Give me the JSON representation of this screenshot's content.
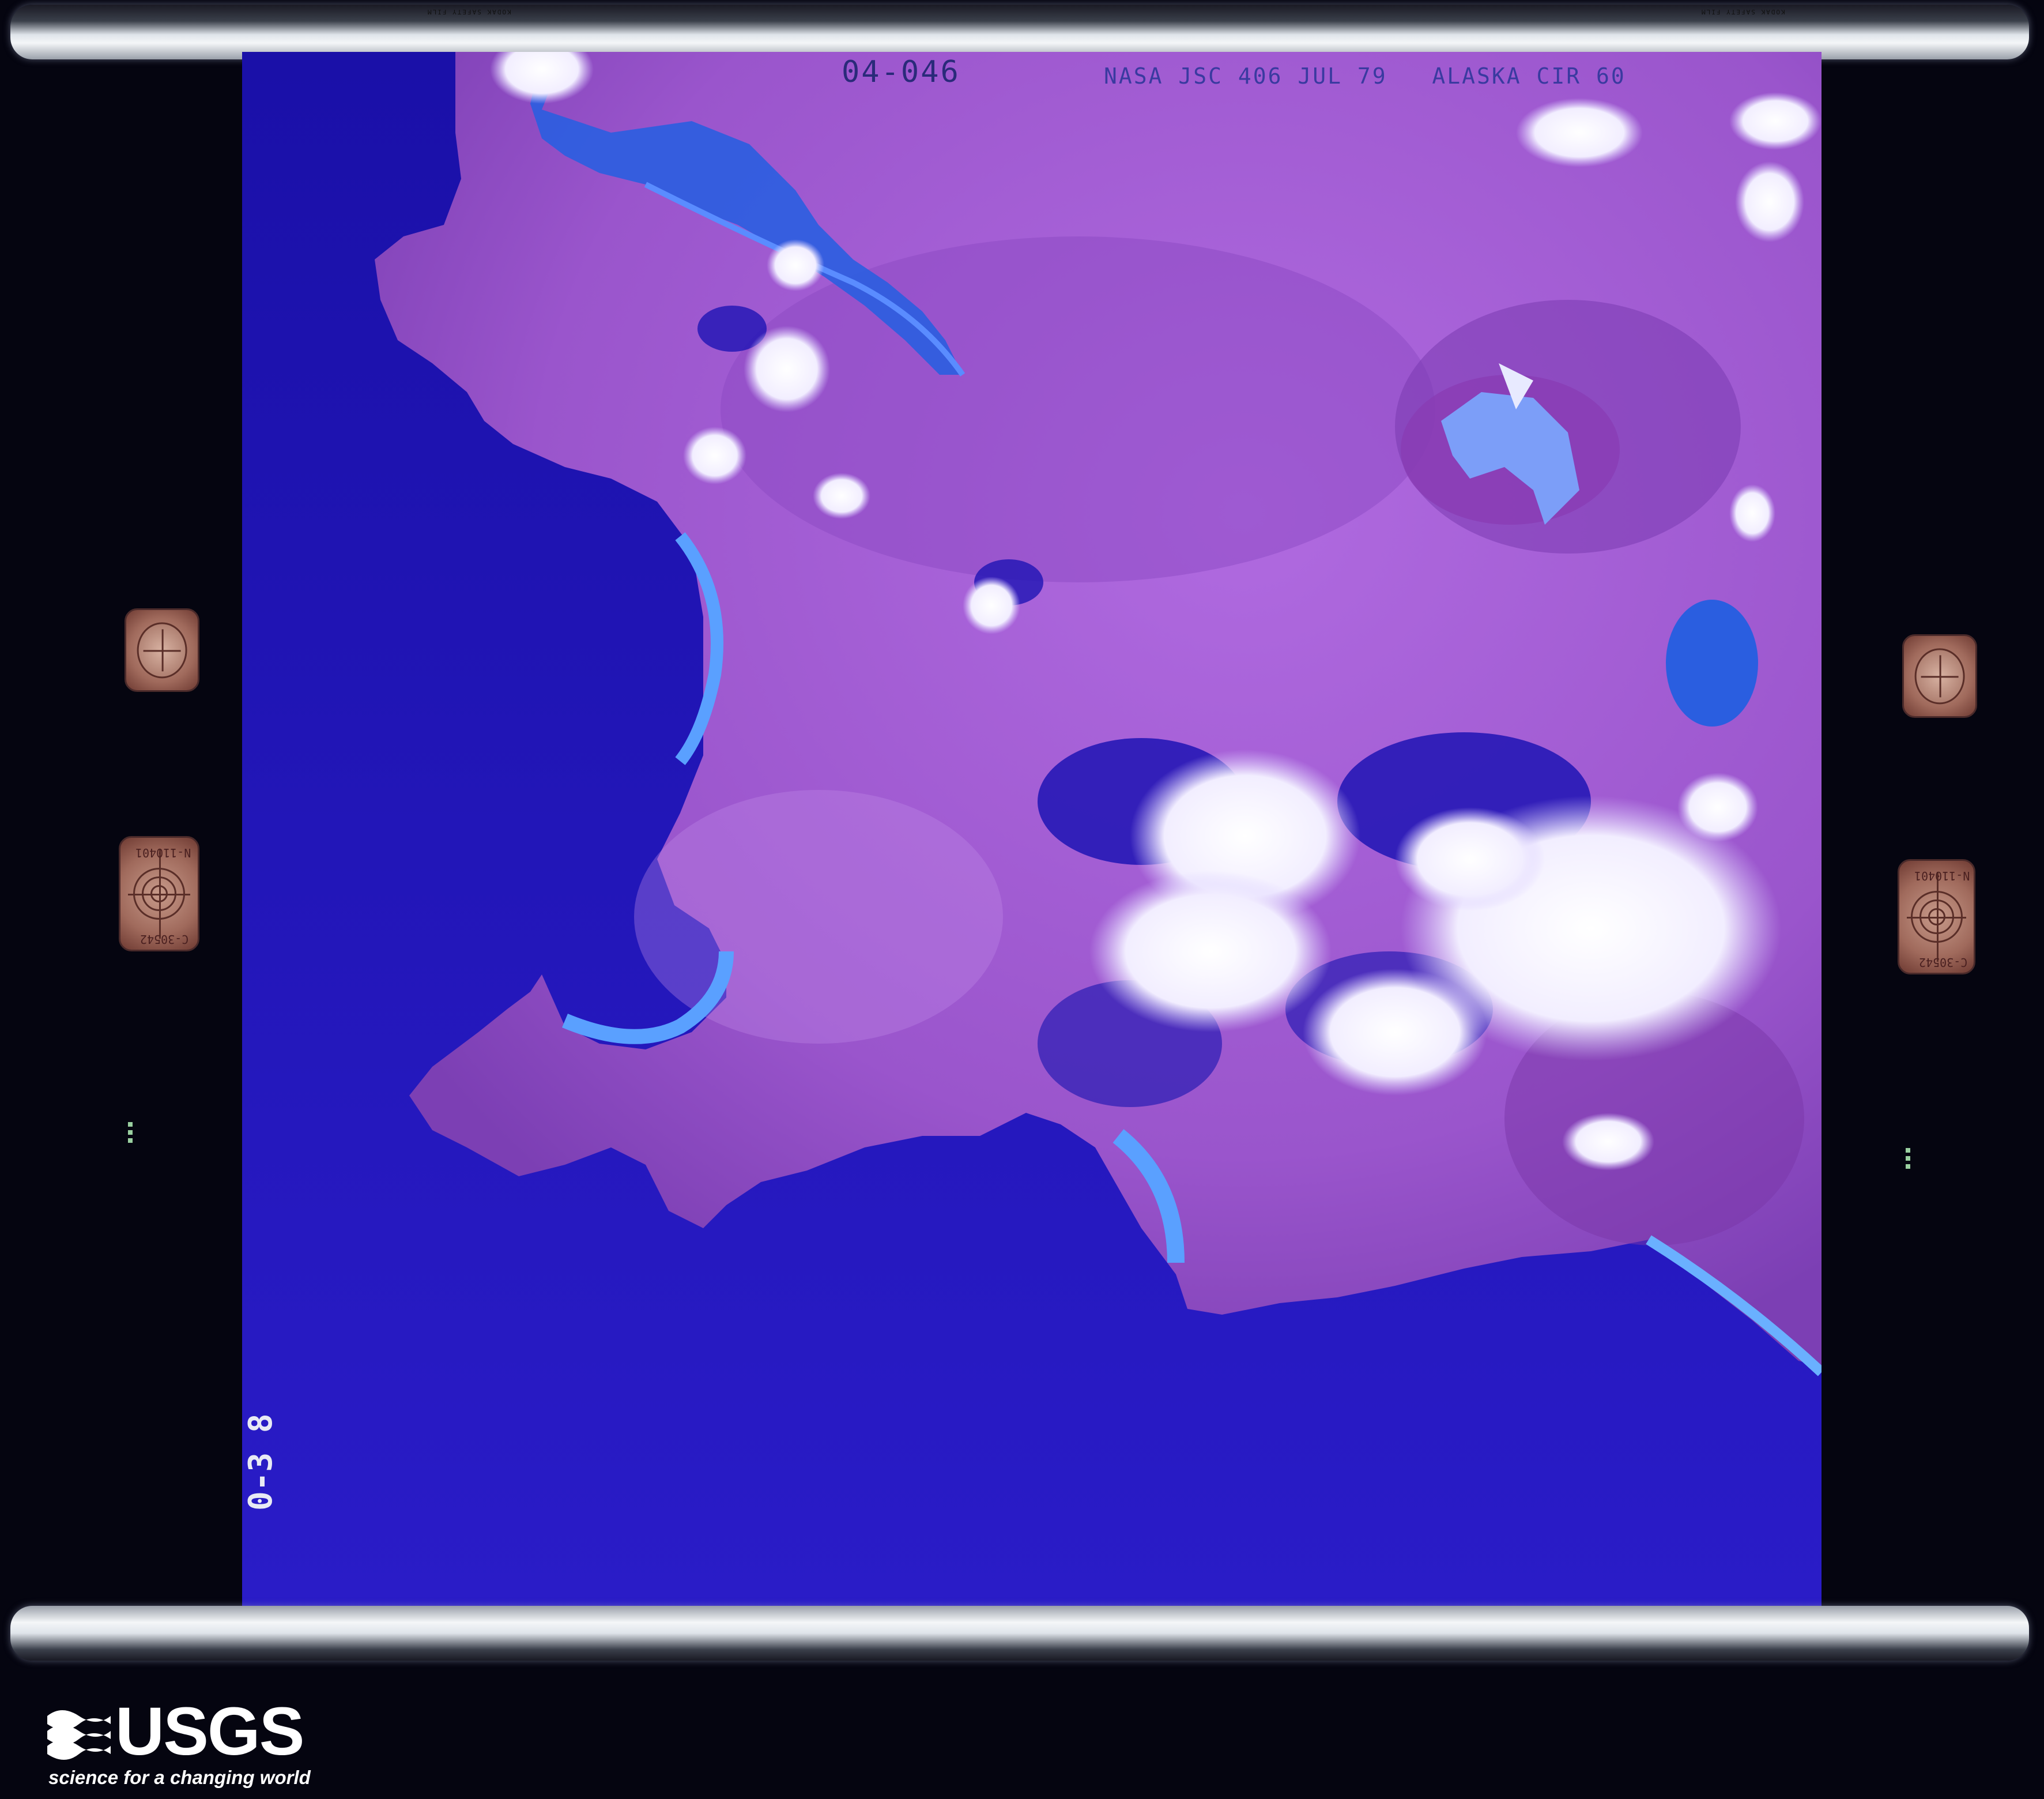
{
  "photo": {
    "frame_number": "04-046",
    "header": "NASA JSC 406 JUL 79   ALASKA CIR 60",
    "roll_code": "0-3 8",
    "film_edge": "KODAK SAFETY FILM",
    "gauge_codes": [
      "N-110401",
      "C-30542"
    ]
  },
  "logo": {
    "wordmark": "USGS",
    "tagline": "science for a changing world"
  },
  "colors": {
    "water": "#1e14b4",
    "land": "#a05ad2",
    "cloud": "#f4f2ff"
  }
}
